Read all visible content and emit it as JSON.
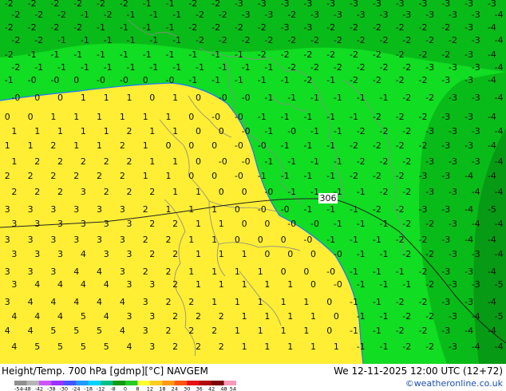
{
  "header": {
    "title": "Height/Temp. 700 hPa [gdmp][°C] NAVGEM",
    "valid_time": "We 12-11-2025 12:00 UTC (12+72)",
    "credit": "©weatheronline.co.uk"
  },
  "map": {
    "contour_label": "306",
    "zero_line_color": "#1e78ff",
    "fill_colors": {
      "yellow": "#ffee33",
      "lightgreen": "#11dd22",
      "green": "#09bb18",
      "darkgreen": "#079a14"
    }
  },
  "colorbar": {
    "tick_labels": [
      "-54",
      "-48",
      "-42",
      "-38",
      "-30",
      "-24",
      "-18",
      "-12",
      "-8",
      "0",
      "8",
      "12",
      "18",
      "24",
      "30",
      "36",
      "42",
      "48",
      "54"
    ],
    "colors": [
      "#8f8f8f",
      "#b5b5b5",
      "#cc55ff",
      "#9933ff",
      "#4455ff",
      "#1e9bff",
      "#00d3ff",
      "#00c08a",
      "#119c11",
      "#22cc22",
      "#ffff33",
      "#ffcc22",
      "#ff9911",
      "#ff5511",
      "#e81111",
      "#b00a0a",
      "#7a0606",
      "#ff99bb"
    ]
  }
}
